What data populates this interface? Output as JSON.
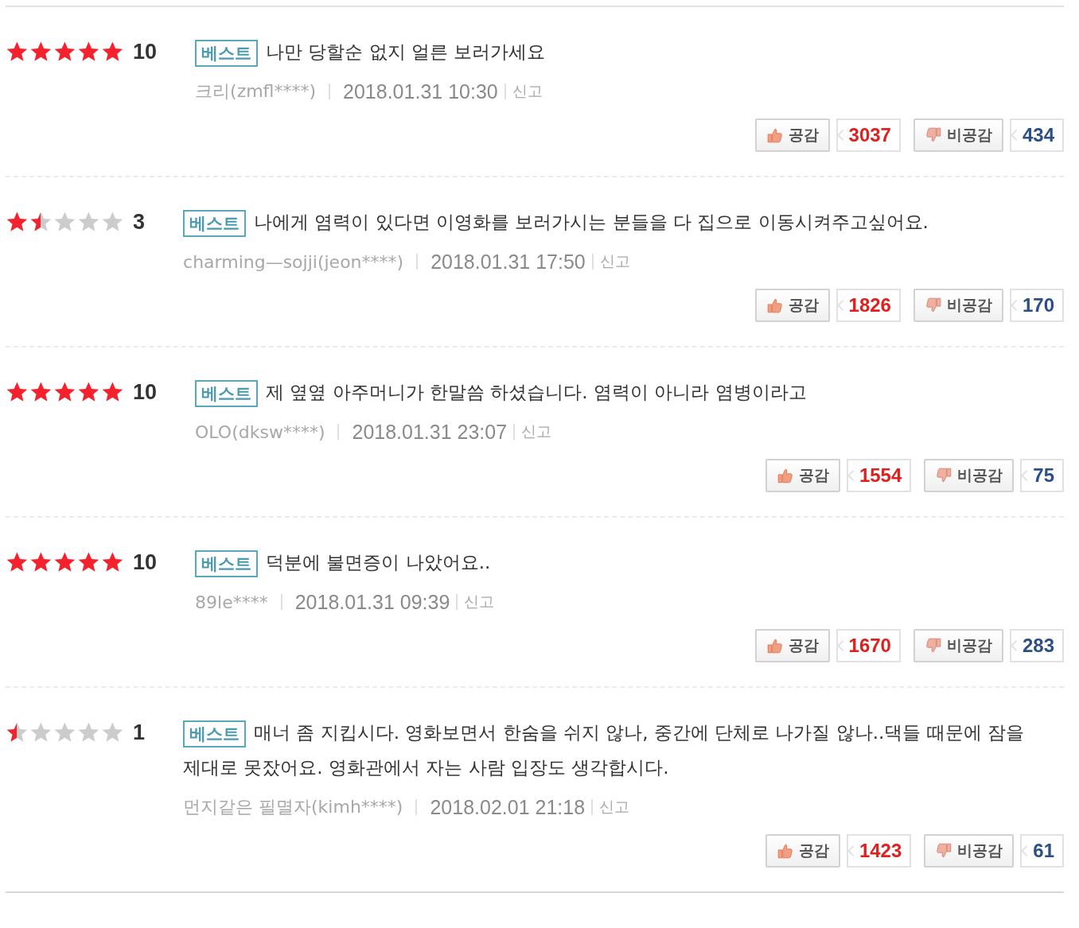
{
  "reviews": [
    {
      "stars": 5,
      "score": "10",
      "badge": "베스트",
      "text": "나만 당할순 없지 얼른 보러가세요",
      "author": "크리(zmfl****)",
      "date": "2018.01.31 10:30",
      "report": "신고",
      "like_label": "공감",
      "likes": "3037",
      "dislike_label": "비공감",
      "dislikes": "434"
    },
    {
      "stars": 1.5,
      "score": "3",
      "badge": "베스트",
      "text": "나에게 염력이 있다면 이영화를 보러가시는 분들을 다 집으로 이동시켜주고싶어요.",
      "author": "charming—sojji(jeon****)",
      "date": "2018.01.31 17:50",
      "report": "신고",
      "like_label": "공감",
      "likes": "1826",
      "dislike_label": "비공감",
      "dislikes": "170"
    },
    {
      "stars": 5,
      "score": "10",
      "badge": "베스트",
      "text": "제 옆옆 아주머니가 한말씀 하셨습니다. 염력이 아니라 염병이라고",
      "author": "OLO(dksw****)",
      "date": "2018.01.31 23:07",
      "report": "신고",
      "like_label": "공감",
      "likes": "1554",
      "dislike_label": "비공감",
      "dislikes": "75"
    },
    {
      "stars": 5,
      "score": "10",
      "badge": "베스트",
      "text": "덕분에 불면증이 나았어요..",
      "author": "89le****",
      "date": "2018.01.31 09:39",
      "report": "신고",
      "like_label": "공감",
      "likes": "1670",
      "dislike_label": "비공감",
      "dislikes": "283"
    },
    {
      "stars": 0.5,
      "score": "1",
      "badge": "베스트",
      "text": "매너 좀 지킵시다. 영화보면서 한숨을 쉬지 않나, 중간에 단체로 나가질 않나..댁들 때문에 잠을 제대로 못잤어요. 영화관에서 자는 사람 입장도 생각합시다.",
      "author": "먼지같은 필멸자(kimh****)",
      "date": "2018.02.01 21:18",
      "report": "신고",
      "like_label": "공감",
      "likes": "1423",
      "dislike_label": "비공감",
      "dislikes": "61"
    }
  ]
}
